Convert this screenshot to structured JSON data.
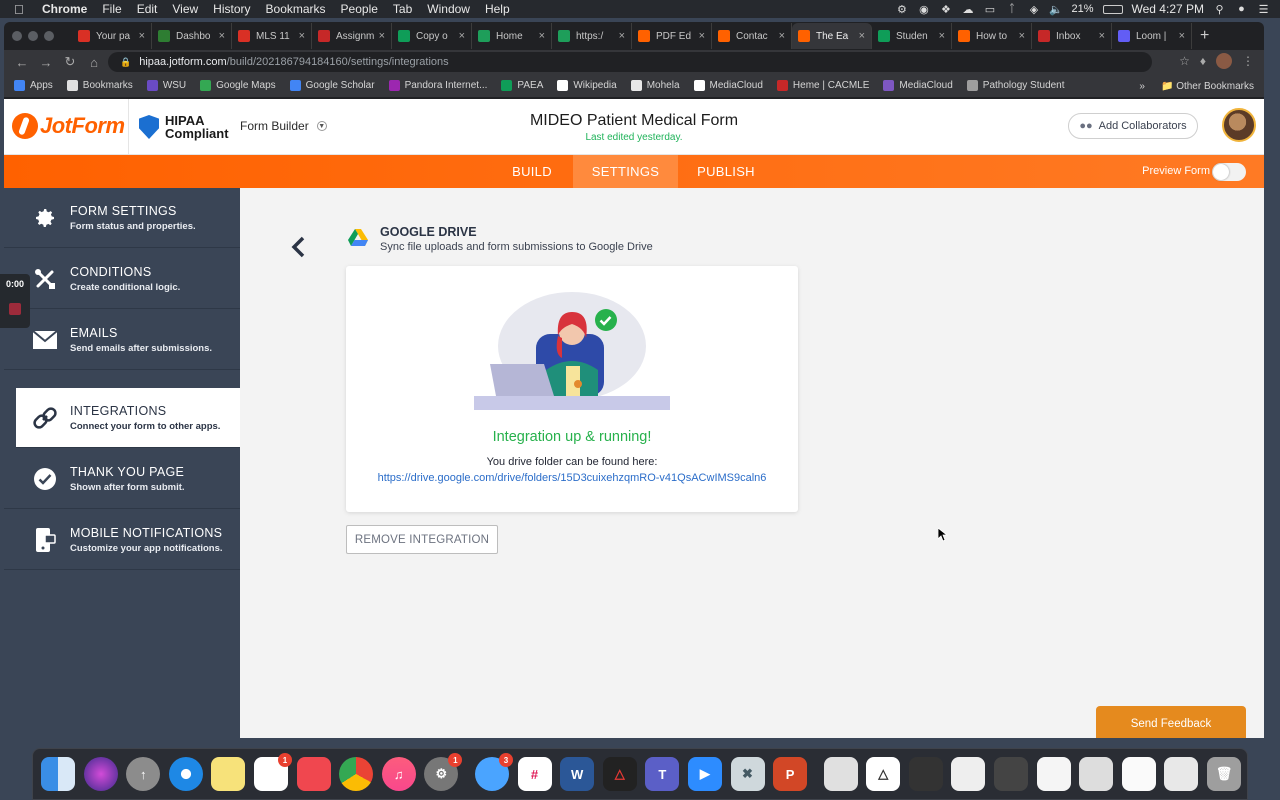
{
  "menubar": {
    "items": [
      "Chrome",
      "File",
      "Edit",
      "View",
      "History",
      "Bookmarks",
      "People",
      "Tab",
      "Window",
      "Help"
    ],
    "battery": "21%",
    "clock": "Wed 4:27 PM"
  },
  "tabs": [
    {
      "title": "Your pa",
      "color": "#d93025"
    },
    {
      "title": "Dashbo",
      "color": "#2e7d32"
    },
    {
      "title": "MLS 11",
      "color": "#d93025"
    },
    {
      "title": "Assignm",
      "color": "#c62828"
    },
    {
      "title": "Copy o",
      "color": "#0f9d58"
    },
    {
      "title": "Home",
      "color": "#1e9e5a"
    },
    {
      "title": "https:/",
      "color": "#1e9e5a"
    },
    {
      "title": "PDF Ed",
      "color": "#ff6100"
    },
    {
      "title": "Contac",
      "color": "#ff6100"
    },
    {
      "title": "The Ea",
      "color": "#ff6100"
    },
    {
      "title": "Studen",
      "color": "#0f9d58"
    },
    {
      "title": "How to",
      "color": "#ff6100"
    },
    {
      "title": "Inbox",
      "color": "#c62828"
    },
    {
      "title": "Loom |",
      "color": "#625df5"
    }
  ],
  "address": {
    "host": "hipaa.jotform.com",
    "path": "/build/202186794184160/settings/integrations"
  },
  "bookmarks": [
    {
      "label": "Apps",
      "color": "#4285f4"
    },
    {
      "label": "Bookmarks",
      "color": "#e0e0e0"
    },
    {
      "label": "WSU",
      "color": "#6a4bc4"
    },
    {
      "label": "Google Maps",
      "color": "#34a853"
    },
    {
      "label": "Google Scholar",
      "color": "#4285f4"
    },
    {
      "label": "Pandora Internet...",
      "color": "#9c27b0"
    },
    {
      "label": "PAEA",
      "color": "#0f9d58"
    },
    {
      "label": "Wikipedia",
      "color": "#ffffff"
    },
    {
      "label": "Mohela",
      "color": "#e8e8e8"
    },
    {
      "label": "MediaCloud",
      "color": "#ffffff"
    },
    {
      "label": "Heme | CACMLE",
      "color": "#c62828"
    },
    {
      "label": "MediaCloud",
      "color": "#7e57c2"
    },
    {
      "label": "Pathology Student",
      "color": "#9e9e9e"
    }
  ],
  "bookmarks_more": "»",
  "other_bookmarks": "Other Bookmarks",
  "header": {
    "brand": "JotForm",
    "hipaa_line1": "HIPAA",
    "hipaa_line2": "Compliant",
    "form_builder": "Form Builder",
    "form_title": "MIDEO Patient Medical Form",
    "last_edited": "Last edited yesterday.",
    "add_collaborators": "Add Collaborators"
  },
  "nav": {
    "build": "BUILD",
    "settings": "SETTINGS",
    "publish": "PUBLISH",
    "preview_form": "Preview Form"
  },
  "sidebar": {
    "items": [
      {
        "title": "FORM SETTINGS",
        "desc": "Form status and properties."
      },
      {
        "title": "CONDITIONS",
        "desc": "Create conditional logic."
      },
      {
        "title": "EMAILS",
        "desc": "Send emails after submissions."
      },
      {
        "title": "INTEGRATIONS",
        "desc": "Connect your form to other apps."
      },
      {
        "title": "THANK YOU PAGE",
        "desc": "Shown after form submit."
      },
      {
        "title": "MOBILE NOTIFICATIONS",
        "desc": "Customize your app notifications."
      }
    ]
  },
  "recorder": {
    "time": "0:00"
  },
  "integration": {
    "title": "GOOGLE DRIVE",
    "subtitle": "Sync file uploads and form submissions to Google Drive",
    "status": "Integration up & running!",
    "folder_text": "You drive folder can be found here:",
    "folder_link": "https://drive.google.com/drive/folders/15D3cuixehzqmRO-v41QsACwIMS9caln6",
    "remove_button": "REMOVE INTEGRATION"
  },
  "send_feedback": "Send Feedback",
  "dock": {
    "badges": {
      "reminders": "1",
      "system_prefs": "1",
      "messages": "3"
    }
  },
  "colors": {
    "jotform_orange": "#ff6100",
    "sidebar_bg": "#3a4556",
    "success_green": "#27b14c",
    "link_blue": "#2b6dc9",
    "feedback_orange": "#e58a1e"
  }
}
